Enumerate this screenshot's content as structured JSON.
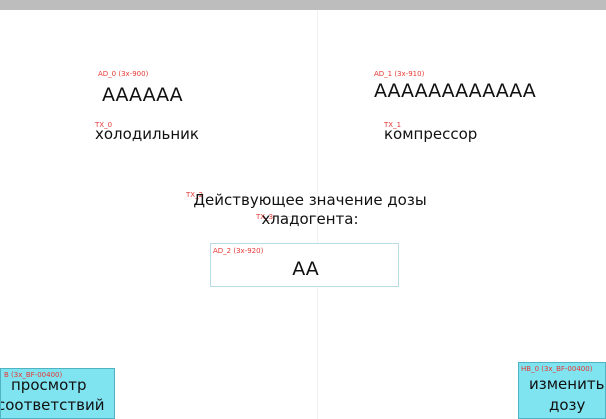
{
  "tags": {
    "ad0": "AD_0 (3x-900)",
    "ad1": "AD_1 (3x-910)",
    "tx0": "TX_0",
    "tx1": "TX_1",
    "tx2": "TX_2",
    "tx3": "TX_3",
    "ad2": "AD_2 (3x-920)",
    "btn_left": "B (3x_BF-00400)",
    "btn_right": "HB_0 (3x_BF-00400)"
  },
  "left_panel": {
    "value": "AAAAAA",
    "label": "холодильник"
  },
  "right_panel": {
    "value": "AAAAAAAAAAAA",
    "label": "компрессор"
  },
  "dose": {
    "label_line1": "Действующее значение дозы",
    "label_line2": "хладогента:",
    "value": "AA"
  },
  "buttons": {
    "view": {
      "line1": "просмотр",
      "line2": "соответствий"
    },
    "change": {
      "line1": "изменить",
      "line2": "дозу"
    }
  },
  "colors": {
    "tag": "#e53935",
    "button_bg": "#7fe3f0",
    "top_border": "#bdbdbd"
  }
}
